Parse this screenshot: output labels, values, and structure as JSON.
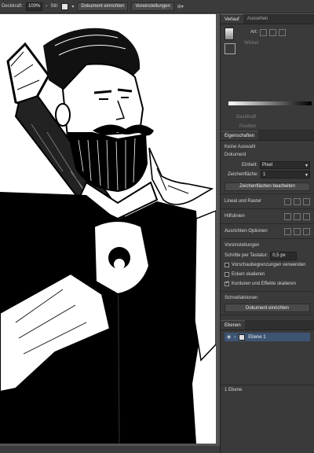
{
  "control_bar": {
    "opacity_label": "Deckkraft:",
    "opacity_value": "100%",
    "style_label": "Stil:",
    "document_setup_button": "Dokument einrichten",
    "preferences_button": "Voreinstellungen"
  },
  "history_panel": {
    "tabs": [
      "Verlauf",
      "Aussehen"
    ],
    "art_label": "Art:",
    "winkel_label": "Winkel",
    "deckkraft_label": "Deckkraft",
    "position_label": "Position"
  },
  "properties_panel": {
    "tab": "Eigenschaften",
    "no_selection": "Keine Auswahl",
    "document_heading": "Dokument",
    "units_label": "Einheit:",
    "units_value": "Pixel",
    "artboard_label": "Zeichenfläche:",
    "artboard_value": "1",
    "edit_artboards_button": "Zeichenflächen bearbeiten",
    "rulers_grids_label": "Lineal und Raster",
    "guides_label": "Hilfslinien",
    "align_options_label": "Ausrichten-Optionen",
    "preferences_heading": "Voreinstellungen",
    "keyboard_increment_label": "Schritte per Tastatur:",
    "keyboard_increment_value": "0,5 px",
    "checkboxes": [
      {
        "label": "Vorschaubegrenzungen verwenden",
        "checked": false
      },
      {
        "label": "Ecken skalieren",
        "checked": false
      },
      {
        "label": "Konturen und Effekte skalieren",
        "checked": true
      }
    ],
    "quick_actions_heading": "Schnellaktionen",
    "document_setup_button": "Dokument einrichten"
  },
  "layers_panel": {
    "tab": "Ebenen",
    "layer_name": "Ebene 1",
    "footer_label": "1 Ebene"
  },
  "colors": {
    "panel_bg": "#3a3a3a",
    "control_bar_bg": "#3b3b3b",
    "selected_layer": "#3d5473"
  }
}
